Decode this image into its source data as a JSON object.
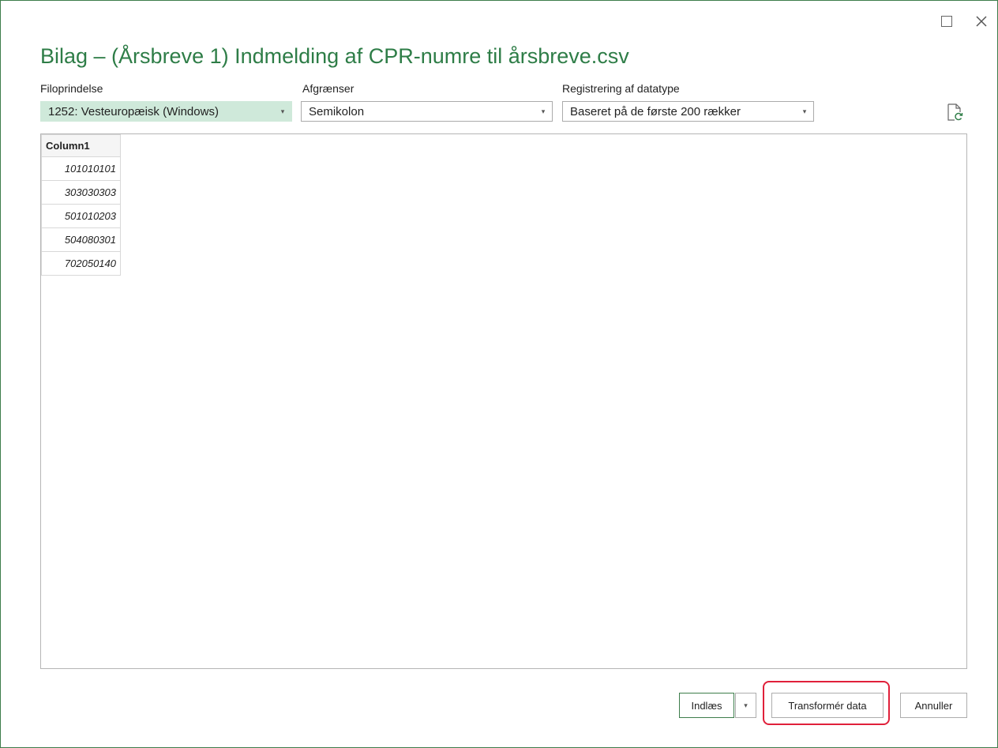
{
  "dialog": {
    "title": "Bilag – (Årsbreve 1) Indmelding af CPR-numre til årsbreve.csv",
    "accent_color": "#2e7d47"
  },
  "window_controls": {
    "maximize_icon": "maximize-icon",
    "close_icon": "close-icon",
    "close_glyph": "✕"
  },
  "fields": {
    "file_origin": {
      "label": "Filoprindelse",
      "value": "1252: Vesteuropæisk (Windows)"
    },
    "delimiter": {
      "label": "Afgrænser",
      "value": "Semikolon"
    },
    "data_type_detection": {
      "label": "Registrering af datatype",
      "value": "Baseret på de første 200 rækker"
    }
  },
  "caret_glyph": "▾",
  "refresh_icon": "refresh-file-icon",
  "preview": {
    "columns": [
      "Column1"
    ],
    "rows": [
      [
        "101010101"
      ],
      [
        "303030303"
      ],
      [
        "501010203"
      ],
      [
        "504080301"
      ],
      [
        "702050140"
      ]
    ]
  },
  "footer": {
    "load_label": "Indlæs",
    "transform_label": "Transformér data",
    "cancel_label": "Annuller",
    "highlight_color": "#e0203a"
  }
}
